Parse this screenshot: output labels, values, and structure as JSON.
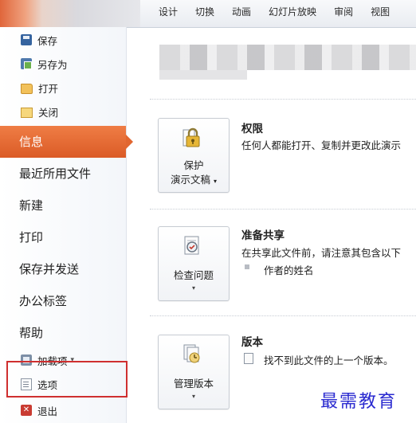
{
  "ribbon": {
    "tabs": [
      "设计",
      "切换",
      "动画",
      "幻灯片放映",
      "审阅",
      "视图"
    ]
  },
  "nav": {
    "commands_top": [
      {
        "label": "保存",
        "icon": "save-icon"
      },
      {
        "label": "另存为",
        "icon": "save-as-icon"
      },
      {
        "label": "打开",
        "icon": "open-folder-icon"
      },
      {
        "label": "关闭",
        "icon": "close-folder-icon"
      }
    ],
    "items": [
      {
        "label": "信息",
        "active": true
      },
      {
        "label": "最近所用文件"
      },
      {
        "label": "新建"
      },
      {
        "label": "打印"
      },
      {
        "label": "保存并发送"
      },
      {
        "label": "办公标签"
      },
      {
        "label": "帮助"
      }
    ],
    "commands_bottom": [
      {
        "label": "加载项",
        "icon": "add-ins-icon",
        "suffix": "▾"
      },
      {
        "label": "选项",
        "icon": "options-icon"
      },
      {
        "label": "退出",
        "icon": "exit-icon"
      }
    ],
    "accent": "#e16630",
    "highlight": "#cf2f2f"
  },
  "sections": {
    "permissions": {
      "title": "权限",
      "desc": "任何人都能打开、复制并更改此演示",
      "button_line1": "保护",
      "button_line2": "演示文稿"
    },
    "prepare": {
      "title": "准备共享",
      "desc": "在共享此文件前，请注意其包含以下",
      "bullet": "作者的姓名",
      "button": "检查问题"
    },
    "versions": {
      "title": "版本",
      "desc": "找不到此文件的上一个版本。",
      "button": "管理版本"
    }
  },
  "watermark": "最需教育"
}
